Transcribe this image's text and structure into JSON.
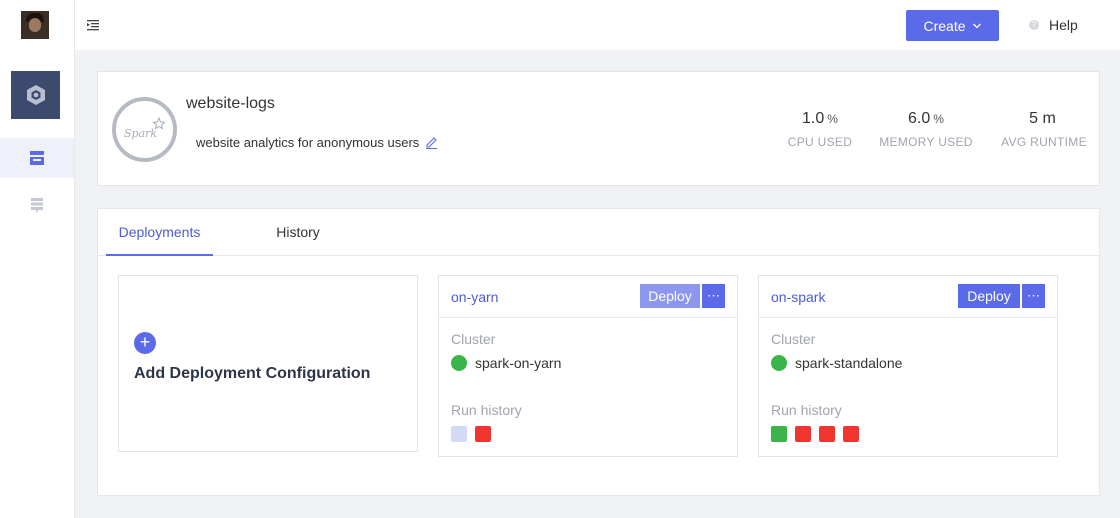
{
  "topbar": {
    "create_label": "Create",
    "help_label": "Help"
  },
  "app": {
    "name": "website-logs",
    "description": "website analytics for anonymous users",
    "logo_text": "Spark",
    "stats": [
      {
        "value": "1.0",
        "unit": "%",
        "label": "CPU USED"
      },
      {
        "value": "6.0",
        "unit": "%",
        "label": "MEMORY USED"
      },
      {
        "value": "5 m",
        "unit": "",
        "label": "AVG RUNTIME"
      }
    ]
  },
  "tabs": [
    {
      "label": "Deployments",
      "active": true
    },
    {
      "label": "History",
      "active": false
    }
  ],
  "add_card": {
    "plus": "+",
    "label": "Add Deployment Configuration"
  },
  "deployments": [
    {
      "name": "on-yarn",
      "deploy_label": "Deploy",
      "more_label": "⋯",
      "cluster_label": "Cluster",
      "cluster_name": "spark-on-yarn",
      "cluster_status_color": "#3ab549",
      "history_label": "Run history",
      "runs": [
        "pending",
        "failed"
      ]
    },
    {
      "name": "on-spark",
      "deploy_label": "Deploy",
      "more_label": "⋯",
      "cluster_label": "Cluster",
      "cluster_name": "spark-standalone",
      "cluster_status_color": "#3ab549",
      "history_label": "Run history",
      "runs": [
        "succeeded",
        "failed",
        "failed",
        "failed"
      ]
    }
  ],
  "colors": {
    "accent": "#5b6ae8",
    "success": "#3ab549",
    "failed": "#f0342e",
    "pending": "#d4d9f5"
  }
}
